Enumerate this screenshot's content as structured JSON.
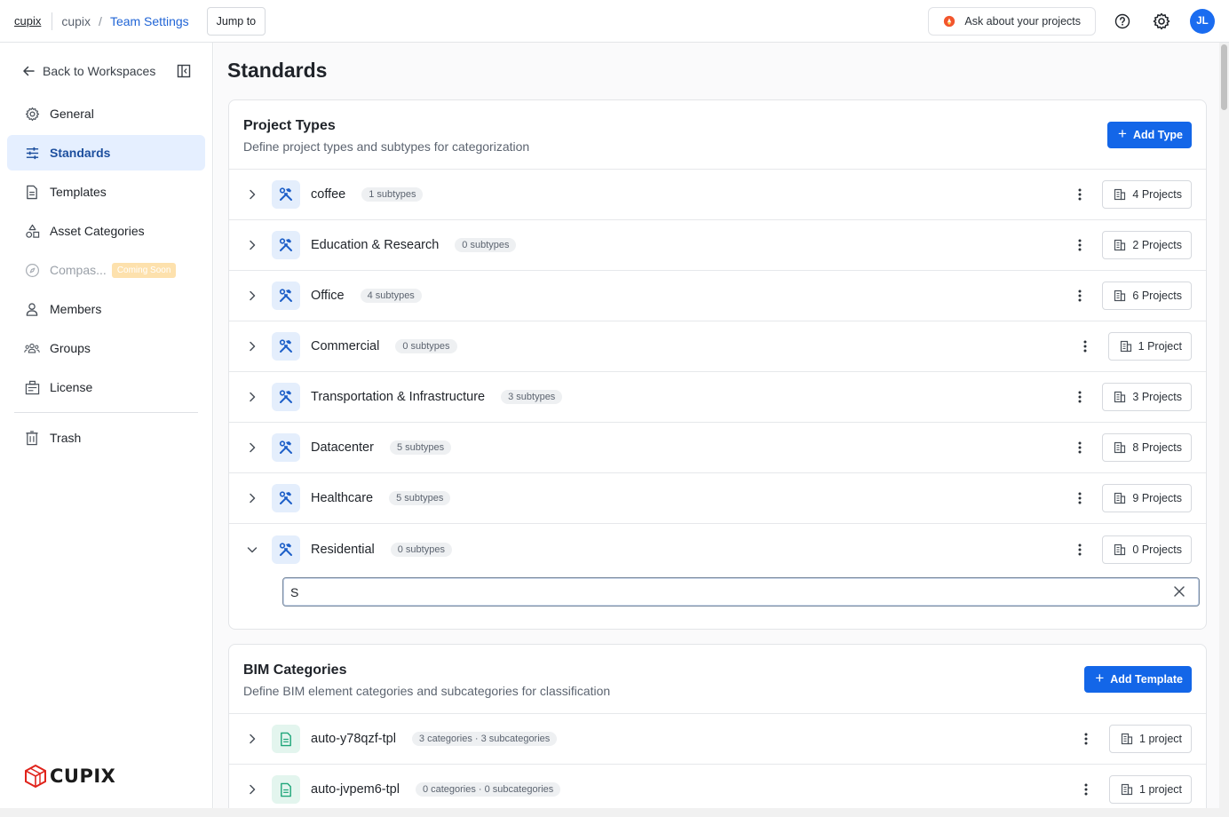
{
  "topbar": {
    "brand": "cupix",
    "breadcrumb_team": "cupix",
    "breadcrumb_sep": "/",
    "breadcrumb_page": "Team Settings",
    "jump_label": "Jump to",
    "ask_label": "Ask about your projects",
    "avatar_initials": "JL"
  },
  "sidebar": {
    "back_label": "Back to Workspaces",
    "items": [
      {
        "label": "General",
        "icon": "gear-icon",
        "active": false
      },
      {
        "label": "Standards",
        "icon": "sliders-icon",
        "active": true
      },
      {
        "label": "Templates",
        "icon": "document-icon",
        "active": false
      },
      {
        "label": "Asset Categories",
        "icon": "shapes-icon",
        "active": false
      },
      {
        "label": "Compas...",
        "icon": "compass-icon",
        "active": false,
        "disabled": true,
        "badge": "Coming Soon"
      },
      {
        "label": "Members",
        "icon": "person-icon",
        "active": false
      },
      {
        "label": "Groups",
        "icon": "group-icon",
        "active": false
      },
      {
        "label": "License",
        "icon": "license-icon",
        "active": false
      }
    ],
    "trash_label": "Trash",
    "logo_text": "CUPIX"
  },
  "main": {
    "title": "Standards",
    "project_types": {
      "title": "Project Types",
      "description": "Define project types and subtypes for categorization",
      "add_label": "Add Type",
      "rows": [
        {
          "name": "coffee",
          "subtypes": "1 subtypes",
          "projects": "4 Projects",
          "expanded": false
        },
        {
          "name": "Education & Research",
          "subtypes": "0 subtypes",
          "projects": "2 Projects",
          "expanded": false
        },
        {
          "name": "Office",
          "subtypes": "4 subtypes",
          "projects": "6 Projects",
          "expanded": false
        },
        {
          "name": "Commercial",
          "subtypes": "0 subtypes",
          "projects": "1 Project",
          "expanded": false
        },
        {
          "name": "Transportation & Infrastructure",
          "subtypes": "3 subtypes",
          "projects": "3 Projects",
          "expanded": false
        },
        {
          "name": "Datacenter",
          "subtypes": "5 subtypes",
          "projects": "8 Projects",
          "expanded": false
        },
        {
          "name": "Healthcare",
          "subtypes": "5 subtypes",
          "projects": "9 Projects",
          "expanded": false
        },
        {
          "name": "Residential",
          "subtypes": "0 subtypes",
          "projects": "0 Projects",
          "expanded": true
        }
      ],
      "new_subtype_value": "S"
    },
    "bim_categories": {
      "title": "BIM Categories",
      "description": "Define BIM element categories and subcategories for classification",
      "add_label": "Add Template",
      "rows": [
        {
          "name": "auto-y78qzf-tpl",
          "meta": "3 categories · 3 subcategories",
          "projects": "1 project"
        },
        {
          "name": "auto-jvpem6-tpl",
          "meta": "0 categories · 0 subcategories",
          "projects": "1 project"
        }
      ]
    }
  },
  "colors": {
    "accent": "#1366e8",
    "active_nav_bg": "#e5efff",
    "coming_soon": "#fde1ad"
  }
}
